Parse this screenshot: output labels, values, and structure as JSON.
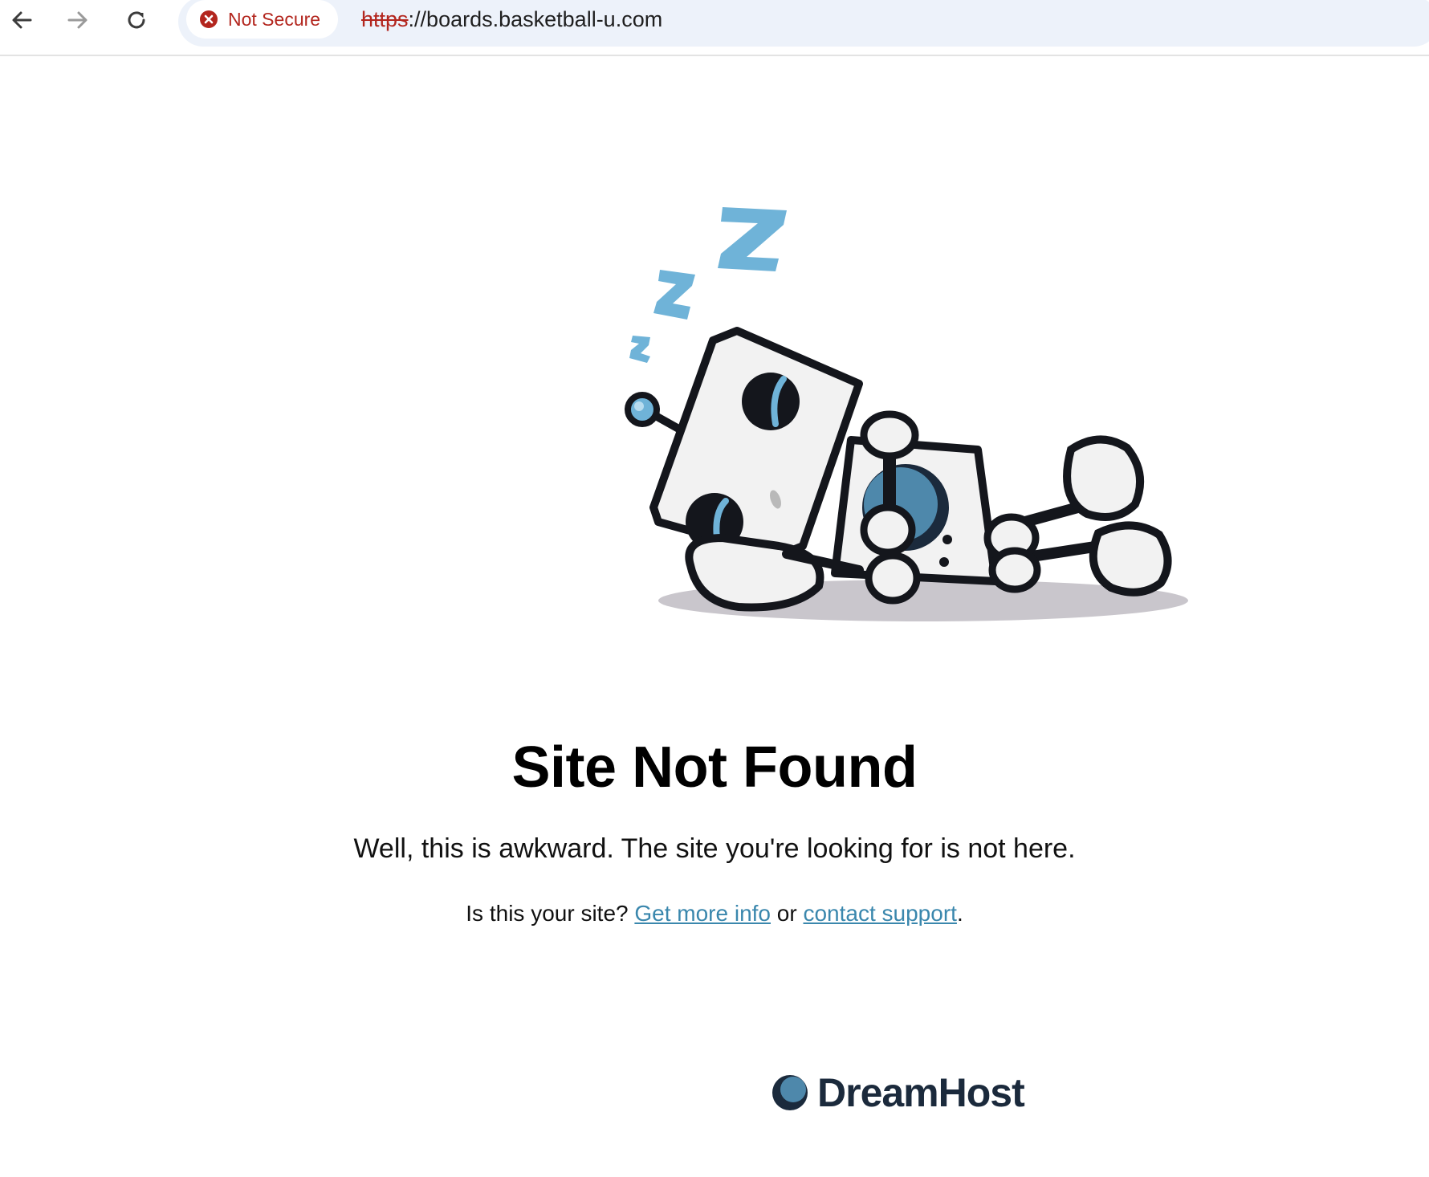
{
  "browser": {
    "security_label": "Not Secure",
    "url_scheme": "https",
    "url_rest": "://boards.basketball-u.com"
  },
  "page": {
    "title": "Site Not Found",
    "subtitle": "Well, this is awkward. The site you're looking for is not here.",
    "help_prefix": "Is this your site? ",
    "link_info": "Get more info",
    "help_middle": " or ",
    "link_support": "contact support",
    "help_suffix": "."
  },
  "footer": {
    "brand": "DreamHost"
  },
  "colors": {
    "insecure_red": "#b3261e",
    "link_blue": "#3a87ad",
    "robot_blue": "#6fb3d8",
    "brand_navy": "#1b2a3c"
  },
  "icons": [
    "back-arrow-icon",
    "forward-arrow-icon",
    "reload-icon",
    "not-secure-icon",
    "sleeping-robot-illustration",
    "dreamhost-logo-icon"
  ]
}
